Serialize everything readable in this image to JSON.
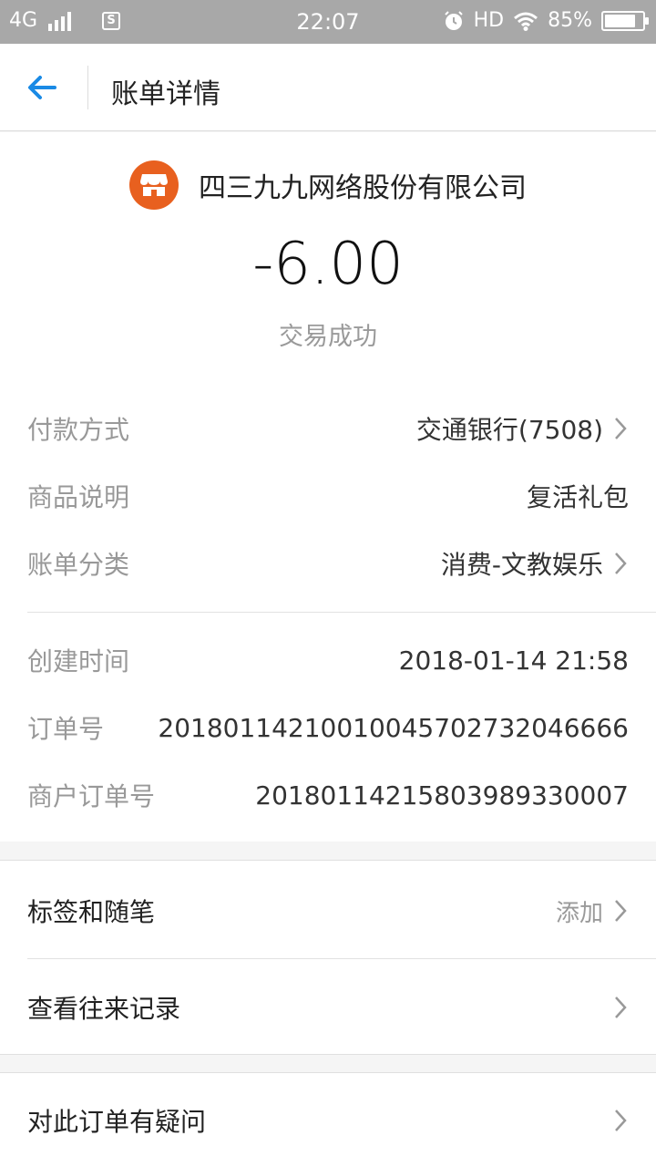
{
  "status_bar": {
    "network": "4G",
    "sim_label": "S",
    "time": "22:07",
    "hd_label": "HD",
    "battery_percent": "85%",
    "battery_level": 0.85,
    "icons": [
      "signal-icon",
      "sim-icon",
      "alarm-icon",
      "wifi-icon",
      "battery-icon"
    ]
  },
  "header": {
    "title": "账单详情",
    "back_icon": "arrow-left-icon"
  },
  "merchant": {
    "name": "四三九九网络股份有限公司",
    "logo_icon": "shop-icon",
    "logo_color": "#e8601f"
  },
  "transaction": {
    "amount": "-6.00",
    "status": "交易成功"
  },
  "details": [
    {
      "label": "付款方式",
      "value": "交通银行(7508)",
      "has_chevron": true
    },
    {
      "label": "商品说明",
      "value": "复活礼包",
      "has_chevron": false
    },
    {
      "label": "账单分类",
      "value": "消费-文教娱乐",
      "has_chevron": true
    }
  ],
  "meta": [
    {
      "label": "创建时间",
      "value": "2018-01-14 21:58"
    },
    {
      "label": "订单号",
      "value": "20180114210010045702732046666"
    },
    {
      "label": "商户订单号",
      "value": "20180114215803989330007"
    }
  ],
  "actions": {
    "tags": {
      "label": "标签和随笔",
      "action": "添加"
    },
    "history": {
      "label": "查看往来记录"
    },
    "question": {
      "label": "对此订单有疑问"
    }
  },
  "colors": {
    "accent": "#1a8ae5",
    "status_bar": "#a8a8a8"
  }
}
